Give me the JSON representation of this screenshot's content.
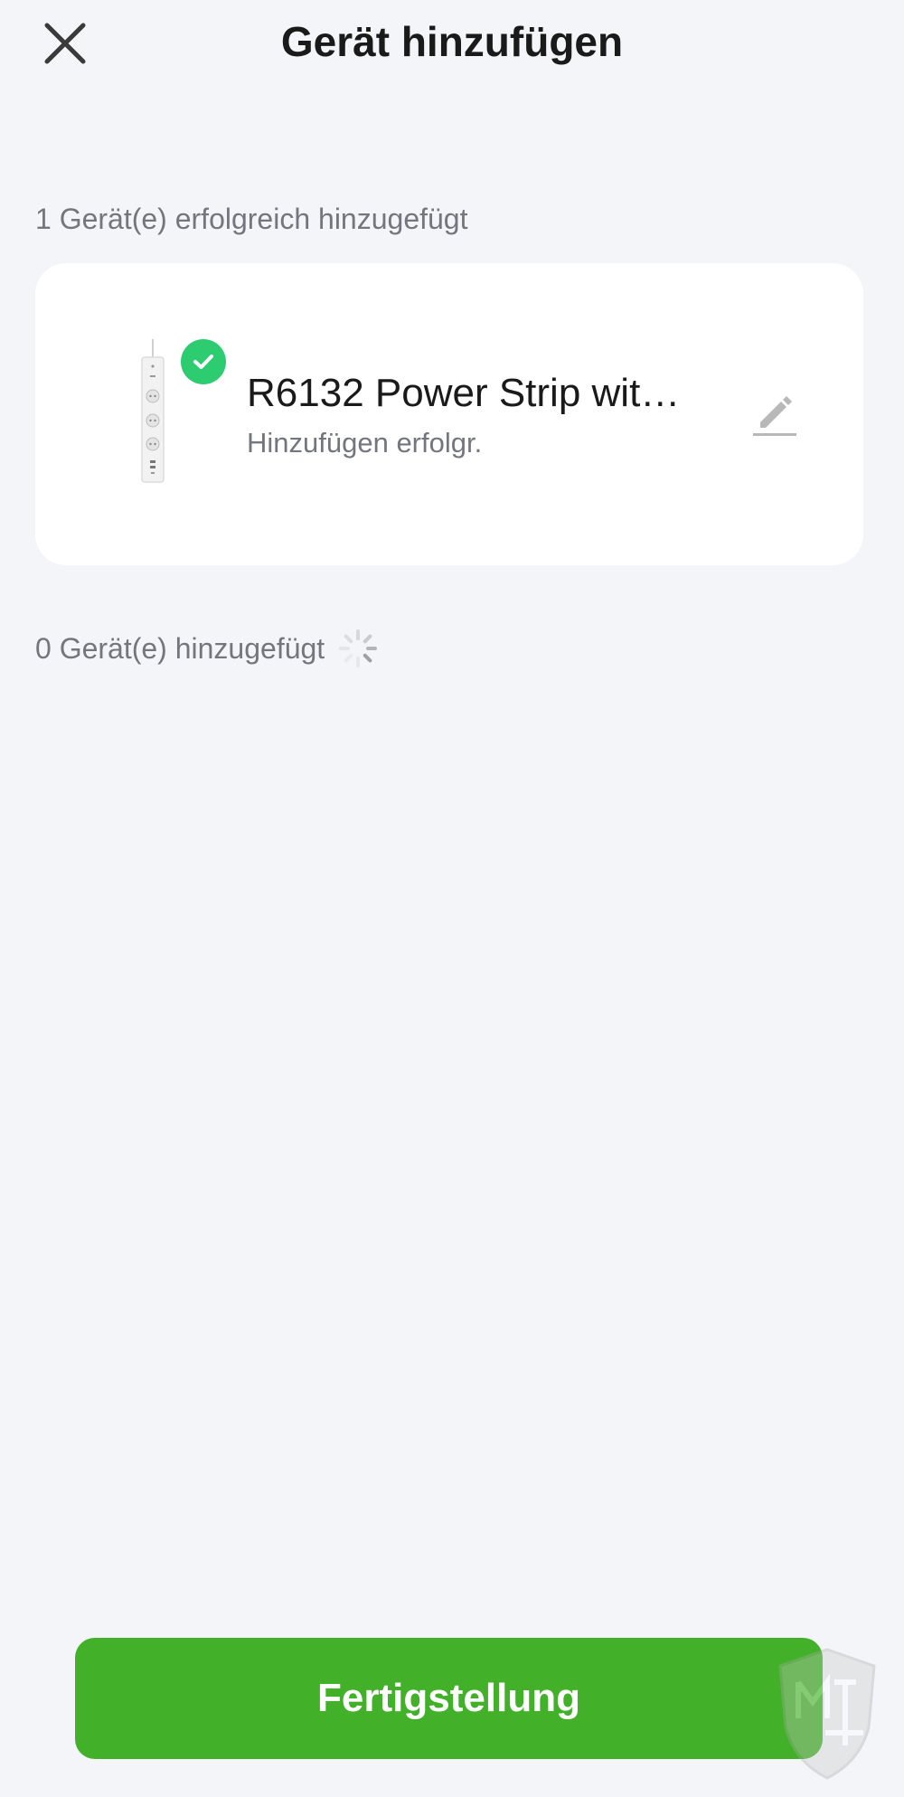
{
  "header": {
    "title": "Gerät hinzufügen",
    "close_icon": "close-icon"
  },
  "success_section": {
    "label": "1 Gerät(e) erfolgreich hinzugefügt",
    "devices": [
      {
        "name": "R6132 Power Strip wit…",
        "status": "Hinzufügen erfolgr.",
        "badge_icon": "check-icon",
        "edit_icon": "pencil-icon",
        "image": "power-strip-image"
      }
    ]
  },
  "pending_section": {
    "label": "0 Gerät(e) hinzugefügt",
    "spinner_icon": "loading-spinner-icon"
  },
  "footer": {
    "finish_label": "Fertigstellung"
  },
  "colors": {
    "background": "#f4f5f9",
    "card": "#ffffff",
    "success_badge": "#2ecc71",
    "primary_button": "#43b02a",
    "secondary_text": "#74767d"
  }
}
